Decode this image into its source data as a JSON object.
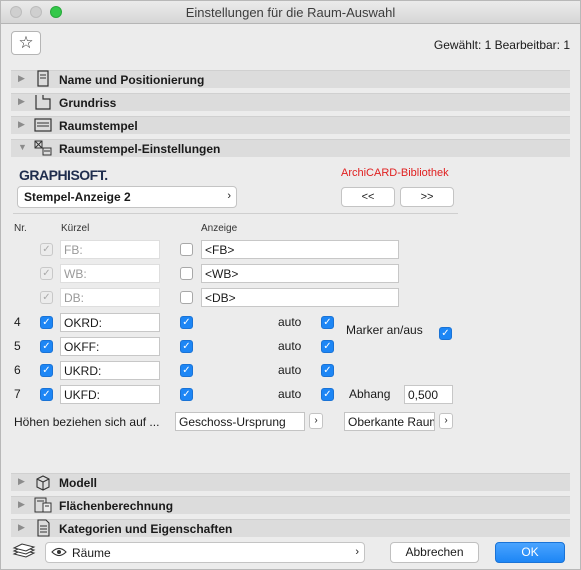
{
  "window": {
    "title": "Einstellungen für die Raum-Auswahl"
  },
  "toolbar": {
    "favorites_icon": "star-icon",
    "selection_info": "Gewählt: 1 Bearbeitbar: 1"
  },
  "sections": [
    {
      "label": "Name und Positionierung",
      "icon": "positioning-icon",
      "expanded": false
    },
    {
      "label": "Grundriss",
      "icon": "floor-plan-icon",
      "expanded": false
    },
    {
      "label": "Raumstempel",
      "icon": "zone-stamp-icon",
      "expanded": false
    },
    {
      "label": "Raumstempel-Einstellungen",
      "icon": "stamp-settings-icon",
      "expanded": true
    },
    {
      "label": "Modell",
      "icon": "model-icon",
      "expanded": false
    },
    {
      "label": "Flächenberechnung",
      "icon": "area-calc-icon",
      "expanded": false
    },
    {
      "label": "Kategorien und Eigenschaften",
      "icon": "categories-icon",
      "expanded": false
    }
  ],
  "stamp": {
    "brand": "GRAPHISOFT.",
    "library": "ArchiCARD-Bibliothek",
    "selected": "Stempel-Anzeige 2",
    "prev_label": "<<",
    "next_label": ">>"
  },
  "columns": {
    "nr": "Nr.",
    "short": "Kürzel",
    "display": "Anzeige"
  },
  "static_rows": [
    {
      "short": "FB:",
      "display": "<FB>"
    },
    {
      "short": "WB:",
      "display": "<WB>"
    },
    {
      "short": "DB:",
      "display": "<DB>"
    }
  ],
  "rows": [
    {
      "nr": "4",
      "short": "OKRD:",
      "auto": "auto"
    },
    {
      "nr": "5",
      "short": "OKFF:",
      "auto": "auto"
    },
    {
      "nr": "6",
      "short": "UKRD:",
      "auto": "auto"
    },
    {
      "nr": "7",
      "short": "UKFD:",
      "auto": "auto"
    }
  ],
  "marker_label": "Marker an/aus",
  "offset_label": "Abhang",
  "offset_value": "0,500",
  "heights": {
    "label": "Höhen beziehen sich auf ...",
    "reference1": "Geschoss-Ursprung",
    "reference2": "Oberkante Raum"
  },
  "footer": {
    "scope": "Räume",
    "cancel": "Abbrechen",
    "ok": "OK"
  },
  "colors": {
    "accent": "#1d86f5",
    "library_red": "#e02020",
    "section_bg": "#dcdcdc"
  }
}
